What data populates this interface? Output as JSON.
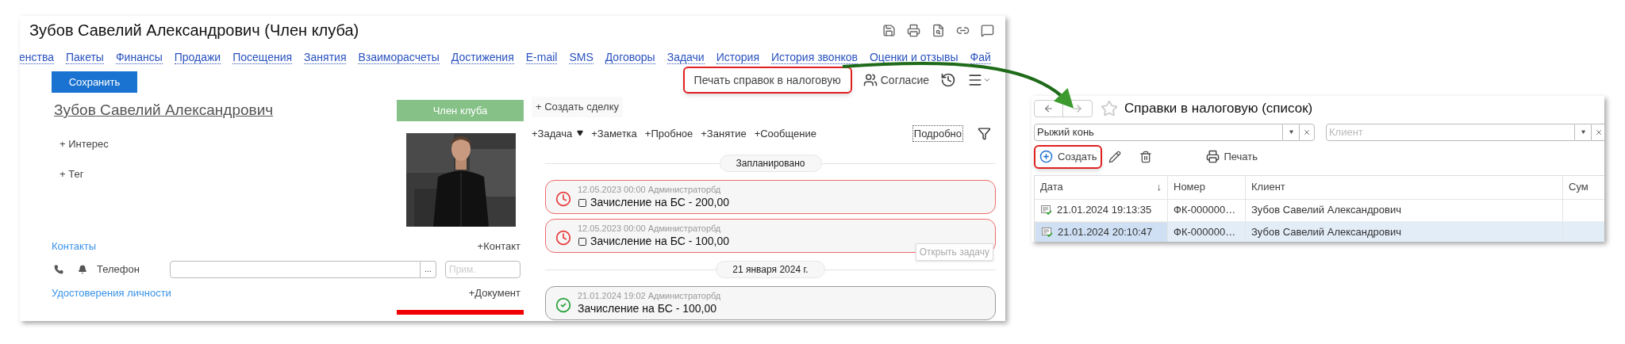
{
  "main_window": {
    "title": "Зубов Савелий Александрович (Член клуба)",
    "tabs": [
      "енства",
      "Пакеты",
      "Финансы",
      "Продажи",
      "Посещения",
      "Занятия",
      "Взаиморасчеты",
      "Достижения",
      "E-mail",
      "SMS",
      "Договоры",
      "Задачи",
      "История",
      "История звонков",
      "Оценки и отзывы",
      "Фай"
    ],
    "save_button": "Сохранить",
    "client_name": "Зубов Савелий Александрович",
    "status_badge": "Член клуба",
    "add_links": [
      "+ Интерес",
      "+ Тег"
    ],
    "contacts": {
      "title": "Контакты",
      "add": "+Контакт",
      "phone_label": "Телефон",
      "more": "...",
      "note_placeholder": "Прим."
    },
    "documents": {
      "title": "Удостоверения личности",
      "add": "+Документ"
    },
    "actions": [
      {
        "kind": "text",
        "label": "Печать справок в налоговую",
        "highlighted": true
      },
      {
        "kind": "consent",
        "label": "Согласие"
      },
      {
        "kind": "history"
      },
      {
        "kind": "menu"
      }
    ],
    "create_deal": "+ Создать сделку",
    "quick_adds": [
      {
        "label": "+Задача",
        "dropdown": true
      },
      {
        "label": "+Заметка",
        "dropdown": false
      },
      {
        "label": "+Пробное",
        "dropdown": false
      },
      {
        "label": "+Занятие",
        "dropdown": false
      },
      {
        "label": "+Сообщение",
        "dropdown": false
      }
    ],
    "details_button": "Подробно",
    "timeline": [
      {
        "kind": "separator",
        "label": "Запланировано"
      },
      {
        "kind": "overdue_task",
        "meta": "12.05.2023 00:00 Администраторбд",
        "title": "Зачисление на БС - 200,00",
        "checked": false
      },
      {
        "kind": "overdue_task",
        "meta": "12.05.2023 00:00 Администраторбд",
        "title": "Зачисление на БС - 100,00",
        "checked": false,
        "tooltip": "Открыть задачу"
      },
      {
        "kind": "separator",
        "label": "21 января 2024 г."
      },
      {
        "kind": "done_task",
        "meta": "21.01.2024 19:02 Администраторбд",
        "title": "Зачисление на БС - 100,00"
      }
    ]
  },
  "list_window": {
    "title": "Справки в налоговую (список)",
    "filters": [
      {
        "value": "Рыжий конь"
      },
      {
        "placeholder": "Клиент"
      }
    ],
    "toolbar": [
      {
        "kind": "create",
        "label": "Создать",
        "highlighted": true
      },
      {
        "kind": "edit"
      },
      {
        "kind": "delete"
      },
      {
        "kind": "print",
        "label": "Печать"
      }
    ],
    "table": {
      "columns": [
        {
          "label": "Дата",
          "sort_mark": "↓"
        },
        {
          "label": "Номер"
        },
        {
          "label": "Клиент"
        },
        {
          "label": "Сум"
        }
      ],
      "rows": [
        {
          "date": "21.01.2024 19:13:35",
          "number": "ФК-000000…",
          "client": "Зубов Савелий Александрович",
          "selected": false
        },
        {
          "date": "21.01.2024 20:10:47",
          "number": "ФК-000000…",
          "client": "Зубов Савелий Александрович",
          "selected": true
        }
      ]
    }
  }
}
